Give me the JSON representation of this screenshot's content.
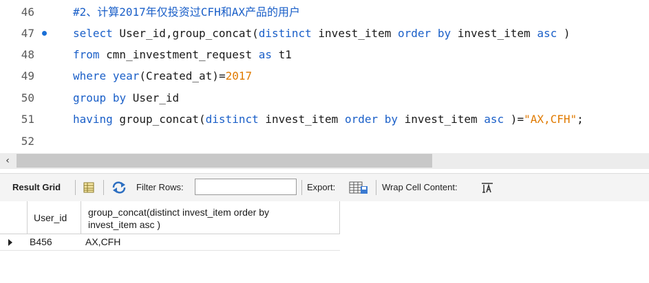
{
  "editor": {
    "lines": [
      {
        "number": "46",
        "text": "#2、计算2017年仅投资过CFH和AX产品的用户"
      },
      {
        "number": "47",
        "t1": "select",
        "t2": " User_id,group_concat(",
        "t3": "distinct",
        "t4": " invest_item ",
        "t5": "order",
        "t6": " ",
        "t7": "by",
        "t8": " invest_item ",
        "t9": "asc",
        "t10": " )"
      },
      {
        "number": "48",
        "t1": "from",
        "t2": " cmn_investment_request ",
        "t3": "as",
        "t4": " t1"
      },
      {
        "number": "49",
        "t1": "where",
        "t2": " ",
        "t3": "year",
        "t4": "(Created_at)=",
        "t5": "2017"
      },
      {
        "number": "50",
        "t1": "group",
        "t2": " ",
        "t3": "by",
        "t4": " User_id"
      },
      {
        "number": "51",
        "t1": "having",
        "t2": " group_concat(",
        "t3": "distinct",
        "t4": " invest_item ",
        "t5": "order",
        "t6": " ",
        "t7": "by",
        "t8": " invest_item ",
        "t9": "asc",
        "t10": " )=",
        "t11": "\"AX,CFH\"",
        "t12": ";"
      },
      {
        "number": "52"
      }
    ],
    "keyword_color": "#1a5fc8",
    "literal_color": "#e07a00"
  },
  "toolbar": {
    "result_grid_label": "Result Grid",
    "filter_label": "Filter Rows:",
    "filter_value": "",
    "export_label": "Export:",
    "wrap_label": "Wrap Cell Content:"
  },
  "grid": {
    "columns": [
      "User_id",
      "group_concat(distinct invest_item order by invest_item asc )"
    ],
    "rows": [
      {
        "user_id": "B456",
        "concat": "AX,CFH"
      }
    ]
  }
}
